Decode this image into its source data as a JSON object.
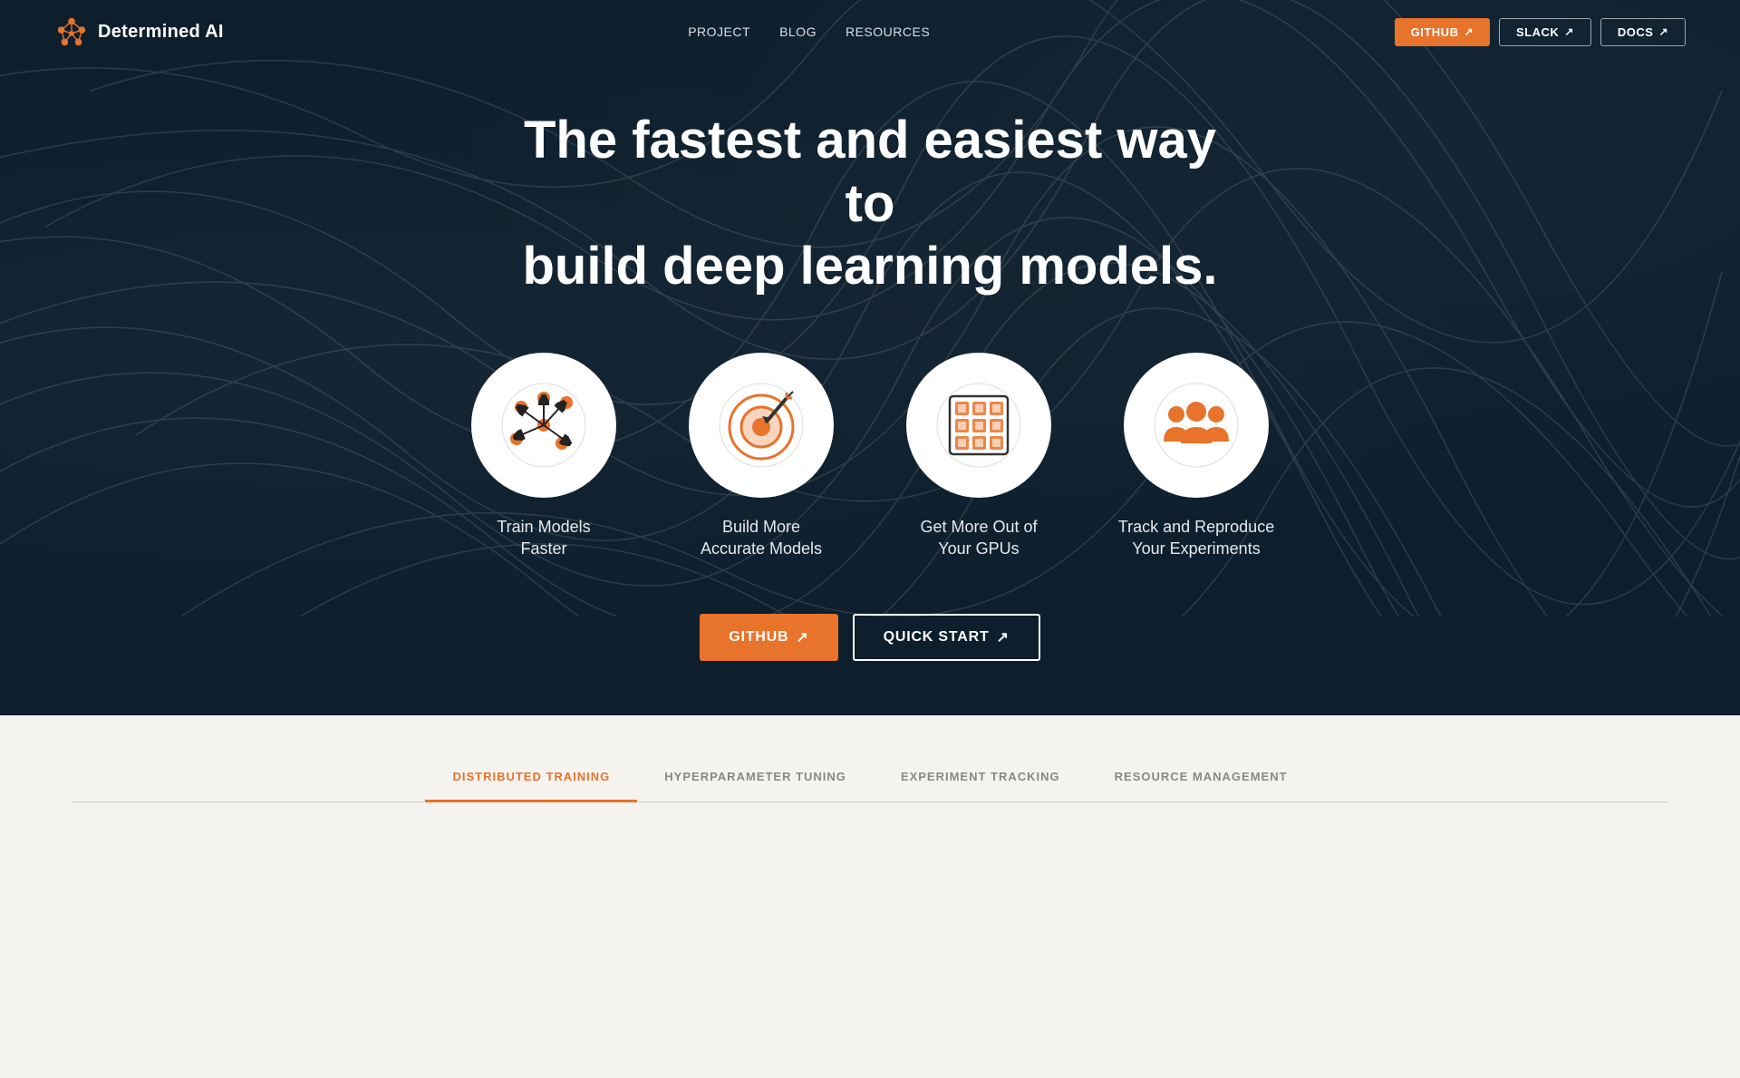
{
  "nav": {
    "logo_text": "Determined AI",
    "links": [
      {
        "label": "PROJECT",
        "id": "project"
      },
      {
        "label": "BLOG",
        "id": "blog"
      },
      {
        "label": "RESOURCES",
        "id": "resources"
      }
    ],
    "buttons": {
      "github": "GITHUB",
      "slack": "SLACK",
      "docs": "DOCS"
    }
  },
  "hero": {
    "title_line1": "The fastest and easiest way to",
    "title_line2": "build deep learning models.",
    "features": [
      {
        "id": "train",
        "label": "Train Models\nFaster"
      },
      {
        "id": "accurate",
        "label": "Build More\nAccurate Models"
      },
      {
        "id": "gpu",
        "label": "Get More Out of\nYour GPUs"
      },
      {
        "id": "track",
        "label": "Track and Reproduce\nYour Experiments"
      }
    ],
    "btn_github": "GITHUB",
    "btn_quickstart": "QUICK START"
  },
  "tabs": {
    "items": [
      {
        "id": "distributed",
        "label": "DISTRIBUTED TRAINING",
        "active": true
      },
      {
        "id": "hyperparameter",
        "label": "HYPERPARAMETER TUNING",
        "active": false
      },
      {
        "id": "experiment",
        "label": "EXPERIMENT TRACKING",
        "active": false
      },
      {
        "id": "resource",
        "label": "RESOURCE MANAGEMENT",
        "active": false
      }
    ]
  },
  "colors": {
    "accent": "#e8732a",
    "bg_dark": "#0d1f2d",
    "bg_light": "#f5f3f0",
    "text_light": "#ffffff",
    "nav_border": "rgba(255,255,255,0.6)"
  }
}
